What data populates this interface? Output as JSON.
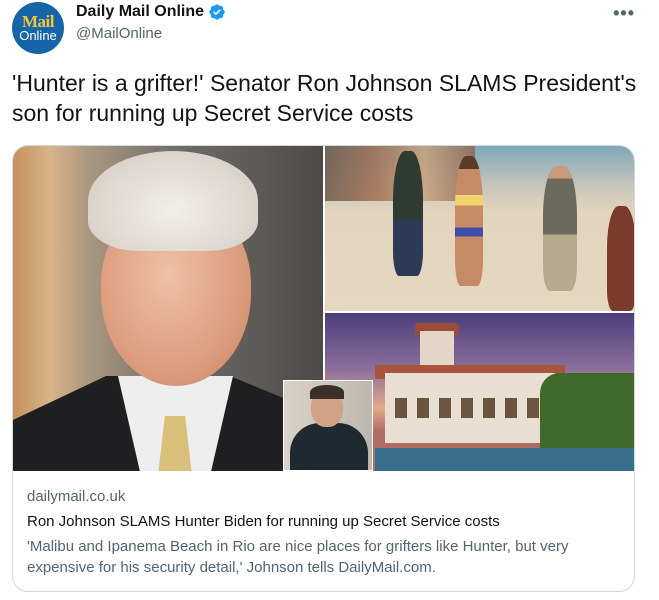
{
  "account": {
    "display_name": "Daily Mail Online",
    "handle": "@MailOnline",
    "avatar_text_top": "Mail",
    "avatar_text_bottom": "Online",
    "verified": true
  },
  "more_menu_label": "•••",
  "tweet_text": "'Hunter is a grifter!' Senator Ron Johnson SLAMS President's son for running up Secret Service costs",
  "card": {
    "domain": "dailymail.co.uk",
    "title": "Ron Johnson SLAMS Hunter Biden for running up Secret Service costs",
    "description": "'Malibu and Ipanema Beach in Rio are nice places for grifters like Hunter, but very expensive for his security detail,' Johnson tells DailyMail.com."
  },
  "colors": {
    "verified_badge": "#1d9bf0",
    "secondary_text": "#536471",
    "border": "#cfd9de",
    "avatar_bg": "#1565a8"
  }
}
